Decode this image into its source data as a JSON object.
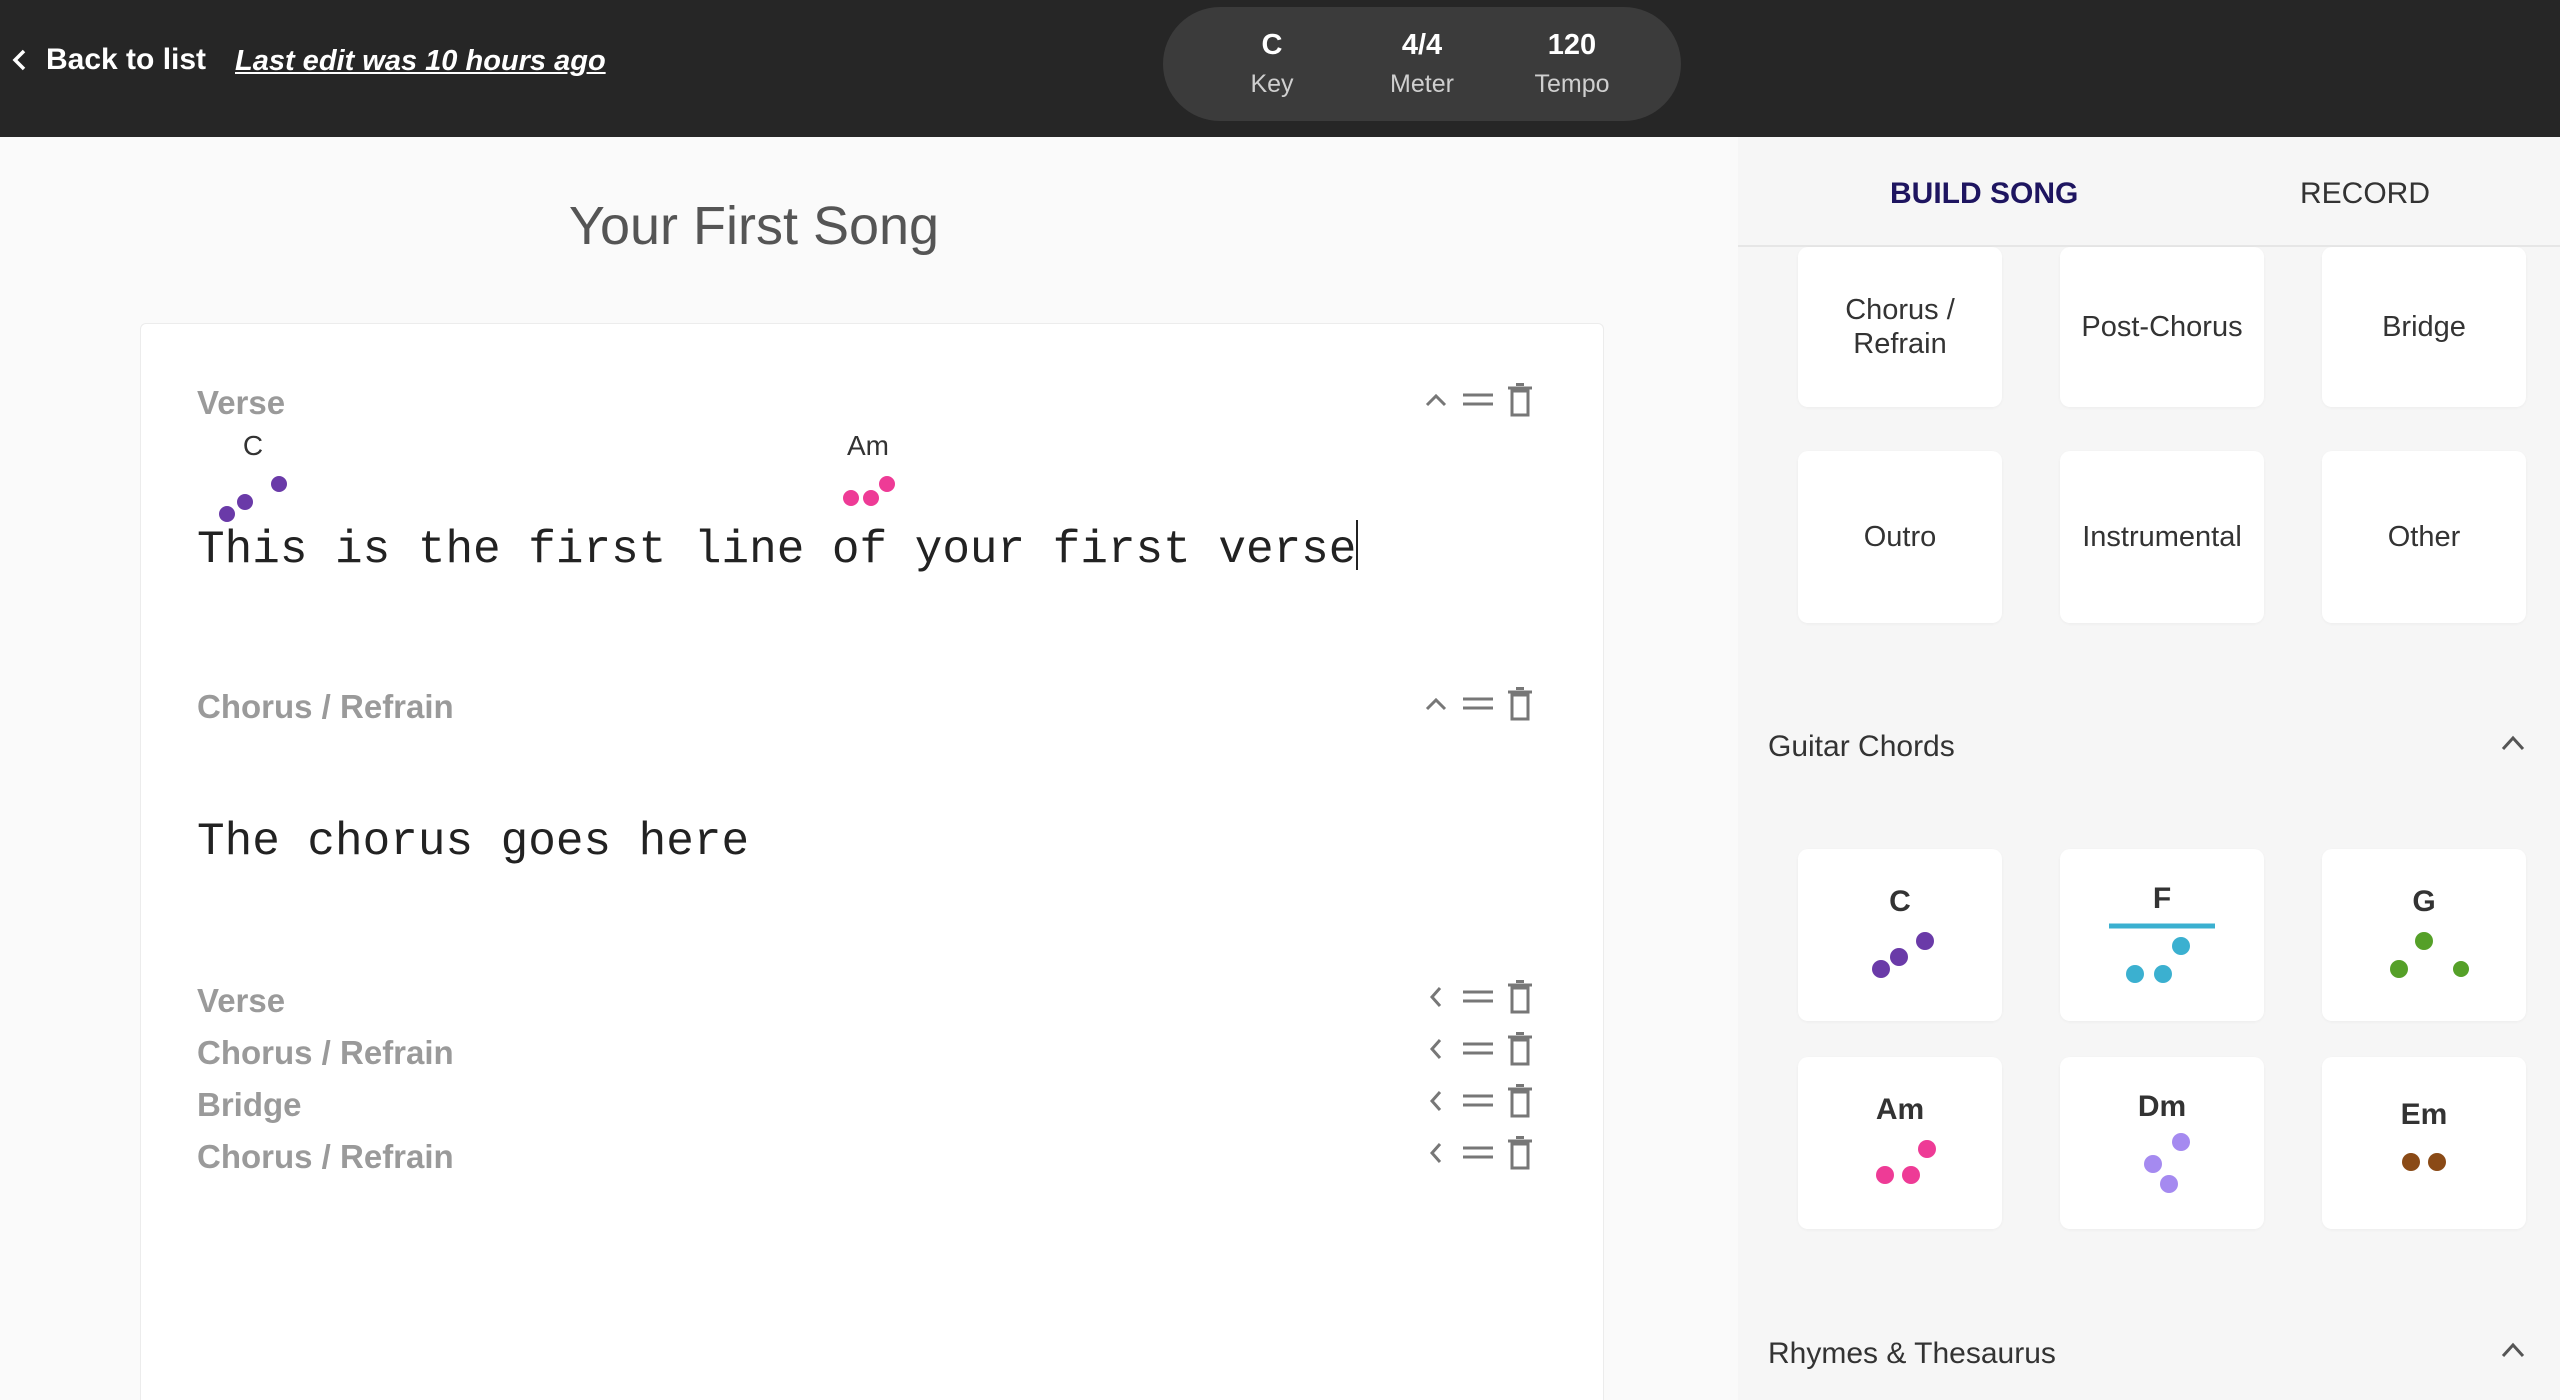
{
  "topbar": {
    "back_label": "Back to list",
    "last_edit": "Last edit was 10 hours ago",
    "key_value": "C",
    "key_label": "Key",
    "meter_value": "4/4",
    "meter_label": "Meter",
    "tempo_value": "120",
    "tempo_label": "Tempo"
  },
  "song": {
    "title": "Your First Song",
    "sections": [
      {
        "label": "Verse",
        "chords": [
          "C",
          "Am"
        ],
        "lyric": "This is the first line of your first verse"
      },
      {
        "label": "Chorus / Refrain",
        "lyric": "The chorus goes here"
      }
    ],
    "outline": [
      "Verse",
      "Chorus / Refrain",
      "Bridge",
      "Chorus / Refrain"
    ]
  },
  "panel": {
    "tabs": [
      "BUILD SONG",
      "RECORD"
    ],
    "section_tiles": [
      "Chorus / Refrain",
      "Post-Chorus",
      "Bridge",
      "Outro",
      "Instrumental",
      "Other"
    ],
    "guitar_chords_title": "Guitar Chords",
    "guitar_chords": [
      "C",
      "F",
      "G",
      "Am",
      "Dm",
      "Em"
    ],
    "rhymes_title": "Rhymes & Thesaurus"
  },
  "colors": {
    "C": "#6a3aa8",
    "F": "#3bb0d0",
    "G": "#55a028",
    "Am": "#ee3b96",
    "Dm": "#a58af0",
    "Em": "#8a4a16",
    "tab_active": "#1e1560"
  },
  "icons": [
    "chevron-left-icon",
    "chevron-up-icon",
    "drag-handle-icon",
    "trash-icon"
  ]
}
